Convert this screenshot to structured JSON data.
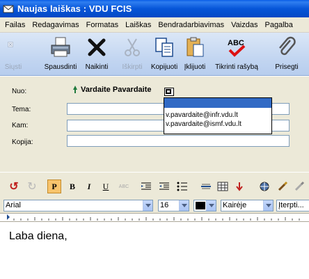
{
  "window": {
    "title": "Naujas laiškas : VDU FCIS"
  },
  "menu": [
    "Failas",
    "Redagavimas",
    "Formatas",
    "Laiškas",
    "Bendradarbiavimas",
    "Vaizdas",
    "Pagalba"
  ],
  "toolbar": {
    "send": "Siųsti",
    "print": "Spausdinti",
    "delete": "Naikinti",
    "cut": "Iškirpti",
    "copy": "Kopijuoti",
    "paste": "Įklijuoti",
    "spell": "Tikrinti rašybą",
    "attach": "Prisegti"
  },
  "fields": {
    "from_label": "Nuo:",
    "from_value": "Vardaite Pavardaite",
    "subject_label": "Tema:",
    "to_label": "Kam:",
    "cc_label": "Kopija:",
    "subject_value": "",
    "to_value": "",
    "cc_value": ""
  },
  "address_dropdown": [
    "",
    "v.pavardaite@infr.vdu.lt",
    "v.pavardaite@ismf.vdu.lt"
  ],
  "format": {
    "font": "Arial",
    "size": "16",
    "color": "#000000",
    "align": "Kairėje",
    "insert": "Įterpti..."
  },
  "editor": {
    "body": "Laba diena,"
  }
}
